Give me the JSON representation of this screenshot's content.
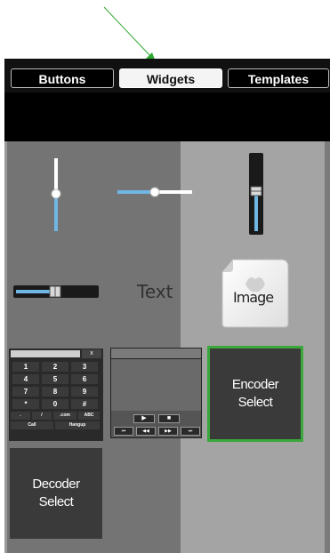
{
  "tabs": [
    {
      "label": "Buttons",
      "active": false
    },
    {
      "label": "Widgets",
      "active": true
    },
    {
      "label": "Templates",
      "active": false
    }
  ],
  "widgets": {
    "vertical_slider": {
      "level": 0.5
    },
    "horizontal_slider": {
      "level": 0.5
    },
    "fader_vertical": {
      "level": 0.55
    },
    "fader_horizontal": {
      "level": 0.55
    },
    "text_label": "Text",
    "image_label": "Image",
    "keypad": {
      "clear_label": "x",
      "keys": [
        "1",
        "2",
        "3",
        "4",
        "5",
        "6",
        "7",
        "8",
        "9",
        "*",
        "0",
        "#"
      ],
      "small_keys": [
        ".",
        "/",
        ".com",
        "ABC"
      ],
      "call_label": "Call",
      "hangup_label": "Hangup"
    },
    "video_player": {
      "buttons_row1": [
        "▶",
        "■"
      ],
      "buttons_row2": [
        "⏮",
        "◀◀",
        "▶▶",
        "⏭"
      ]
    },
    "encoder_select": "Encoder\nSelect",
    "decoder_select": "Decoder\nSelect"
  },
  "colors": {
    "accent_green": "#3aa83a",
    "slider_blue": "#6fb6e4",
    "arrow_green": "#2fa82f"
  }
}
